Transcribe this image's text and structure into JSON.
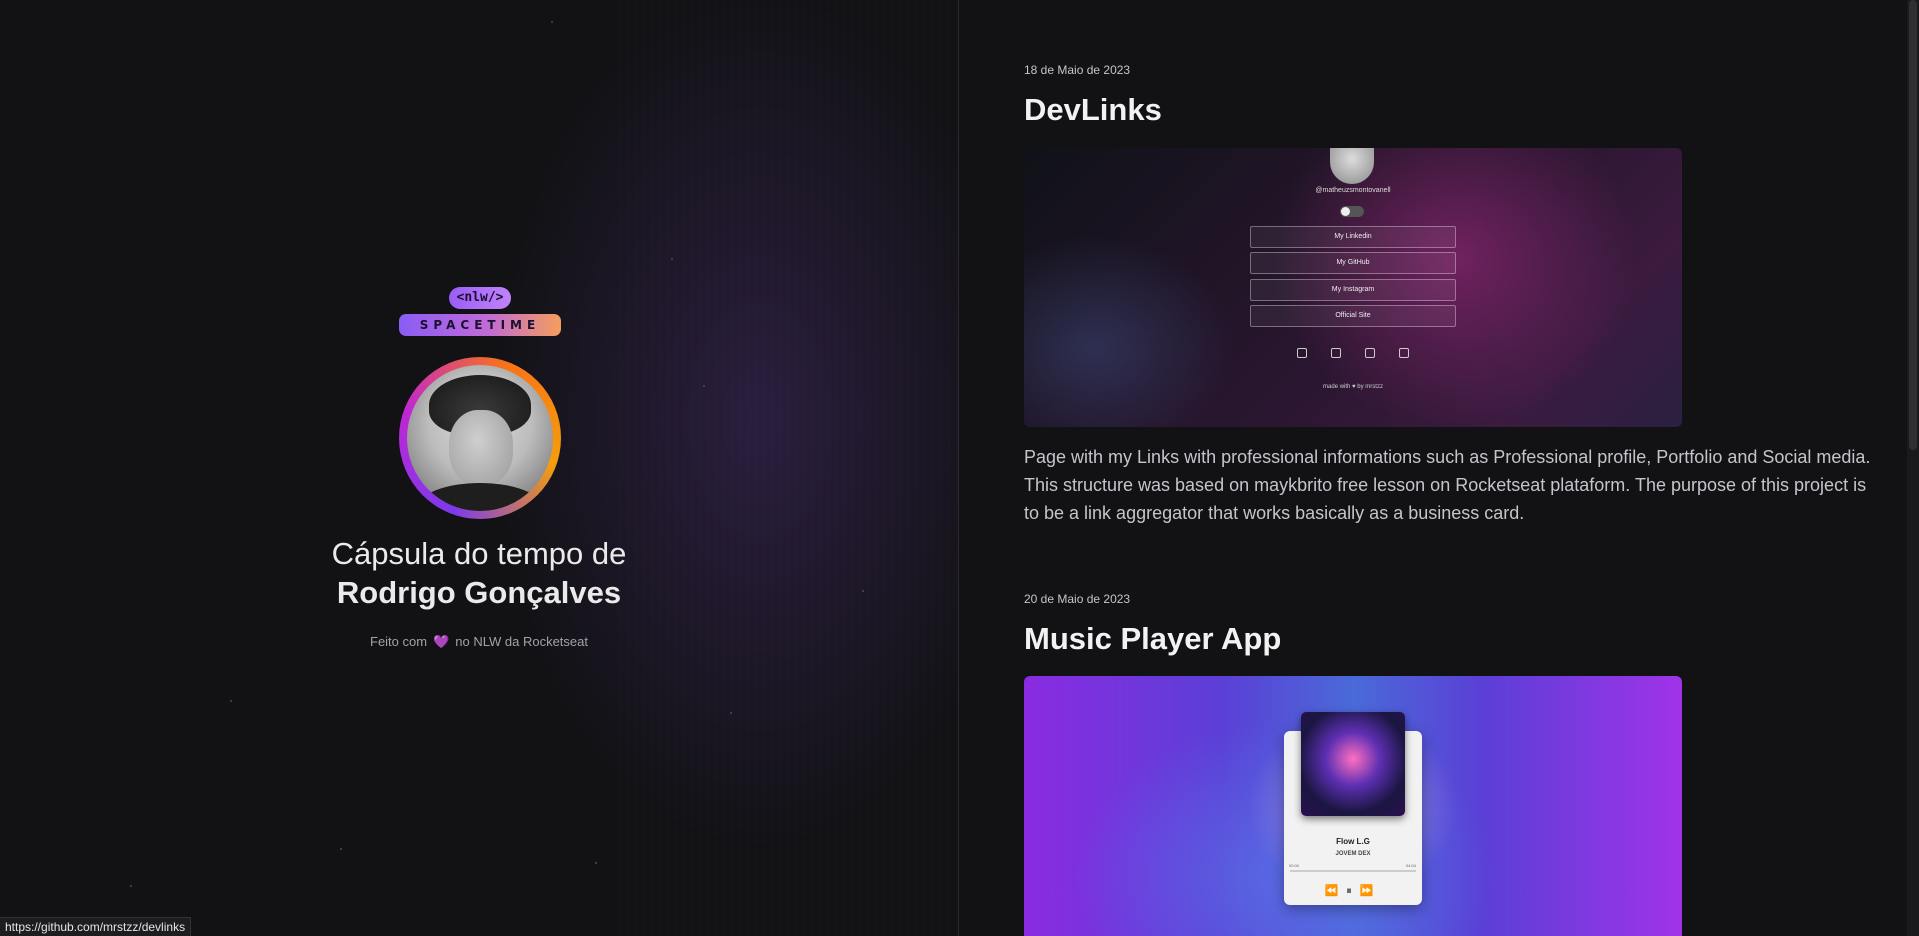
{
  "left": {
    "logo": {
      "tag": "<nlw/>",
      "name": "SPACETIME"
    },
    "title_line1": "Cápsula do tempo de",
    "title_line2": "Rodrigo Gonçalves",
    "made_prefix": "Feito com",
    "made_heart": "💜",
    "made_suffix": "no NLW da Rocketseat"
  },
  "status_bar": {
    "url": "https://github.com/mrstzz/devlinks"
  },
  "memories": [
    {
      "date": "18 de Maio de 2023",
      "title": "DevLinks",
      "content": "Page with my Links with professional informations such as Professional profile, Portfolio and Social media. This structure was based on maykbrito free lesson on Rocketseat plataform. The purpose of this project is to be a link aggregator that works basically as a business card.",
      "preview": {
        "username": "@matheuzsmontovanell",
        "buttons": [
          "My Linkedin",
          "My GitHub",
          "My Instagram",
          "Official Site"
        ],
        "footer": "made with ♥ by mrstzz"
      }
    },
    {
      "date": "20 de Maio de 2023",
      "title": "Music Player App",
      "preview": {
        "song": "Flow L.G",
        "artist": "JOVEM DEX",
        "time_start": "00:00",
        "time_end": "04:04",
        "controls": "⏪⏸⏩"
      }
    }
  ],
  "colors": {
    "accent": "#8b5cf6",
    "background": "#121215",
    "text": "#eaeaea",
    "muted": "#c4c4cc"
  }
}
